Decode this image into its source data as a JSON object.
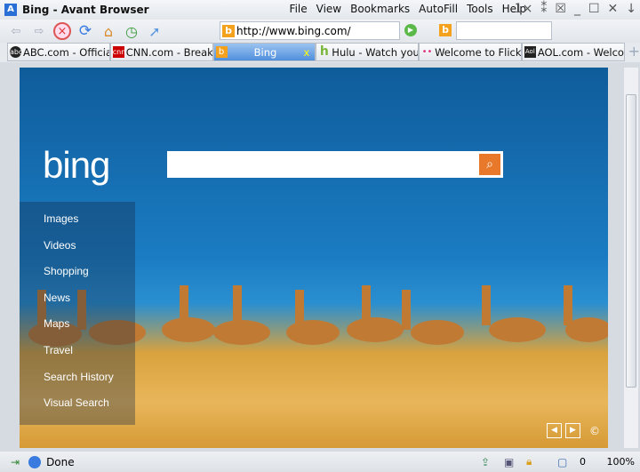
{
  "window": {
    "title": "Bing - Avant Browser"
  },
  "menu": [
    "File",
    "View",
    "Bookmarks",
    "AutoFill",
    "Tools",
    "Help"
  ],
  "address": {
    "url": "http://www.bing.com/",
    "search_value": ""
  },
  "tabs": [
    {
      "label": "ABC.com - Officia...",
      "icon": "abc"
    },
    {
      "label": "CNN.com - Breaki...",
      "icon": "cnn"
    },
    {
      "label": "Bing",
      "icon": "b"
    },
    {
      "label": "Hulu - Watch you...",
      "icon": "h"
    },
    {
      "label": "Welcome to Flickr...",
      "icon": "••"
    },
    {
      "label": "AOL.com - Welco...",
      "icon": "Aol"
    }
  ],
  "bing": {
    "logo": "bing",
    "search_value": "",
    "nav": [
      "Images",
      "Videos",
      "Shopping",
      "News",
      "Maps",
      "Travel",
      "Search History",
      "Visual Search"
    ],
    "copyright": "©"
  },
  "status": {
    "text": "Done",
    "popup_count": "0",
    "zoom": "100%"
  }
}
